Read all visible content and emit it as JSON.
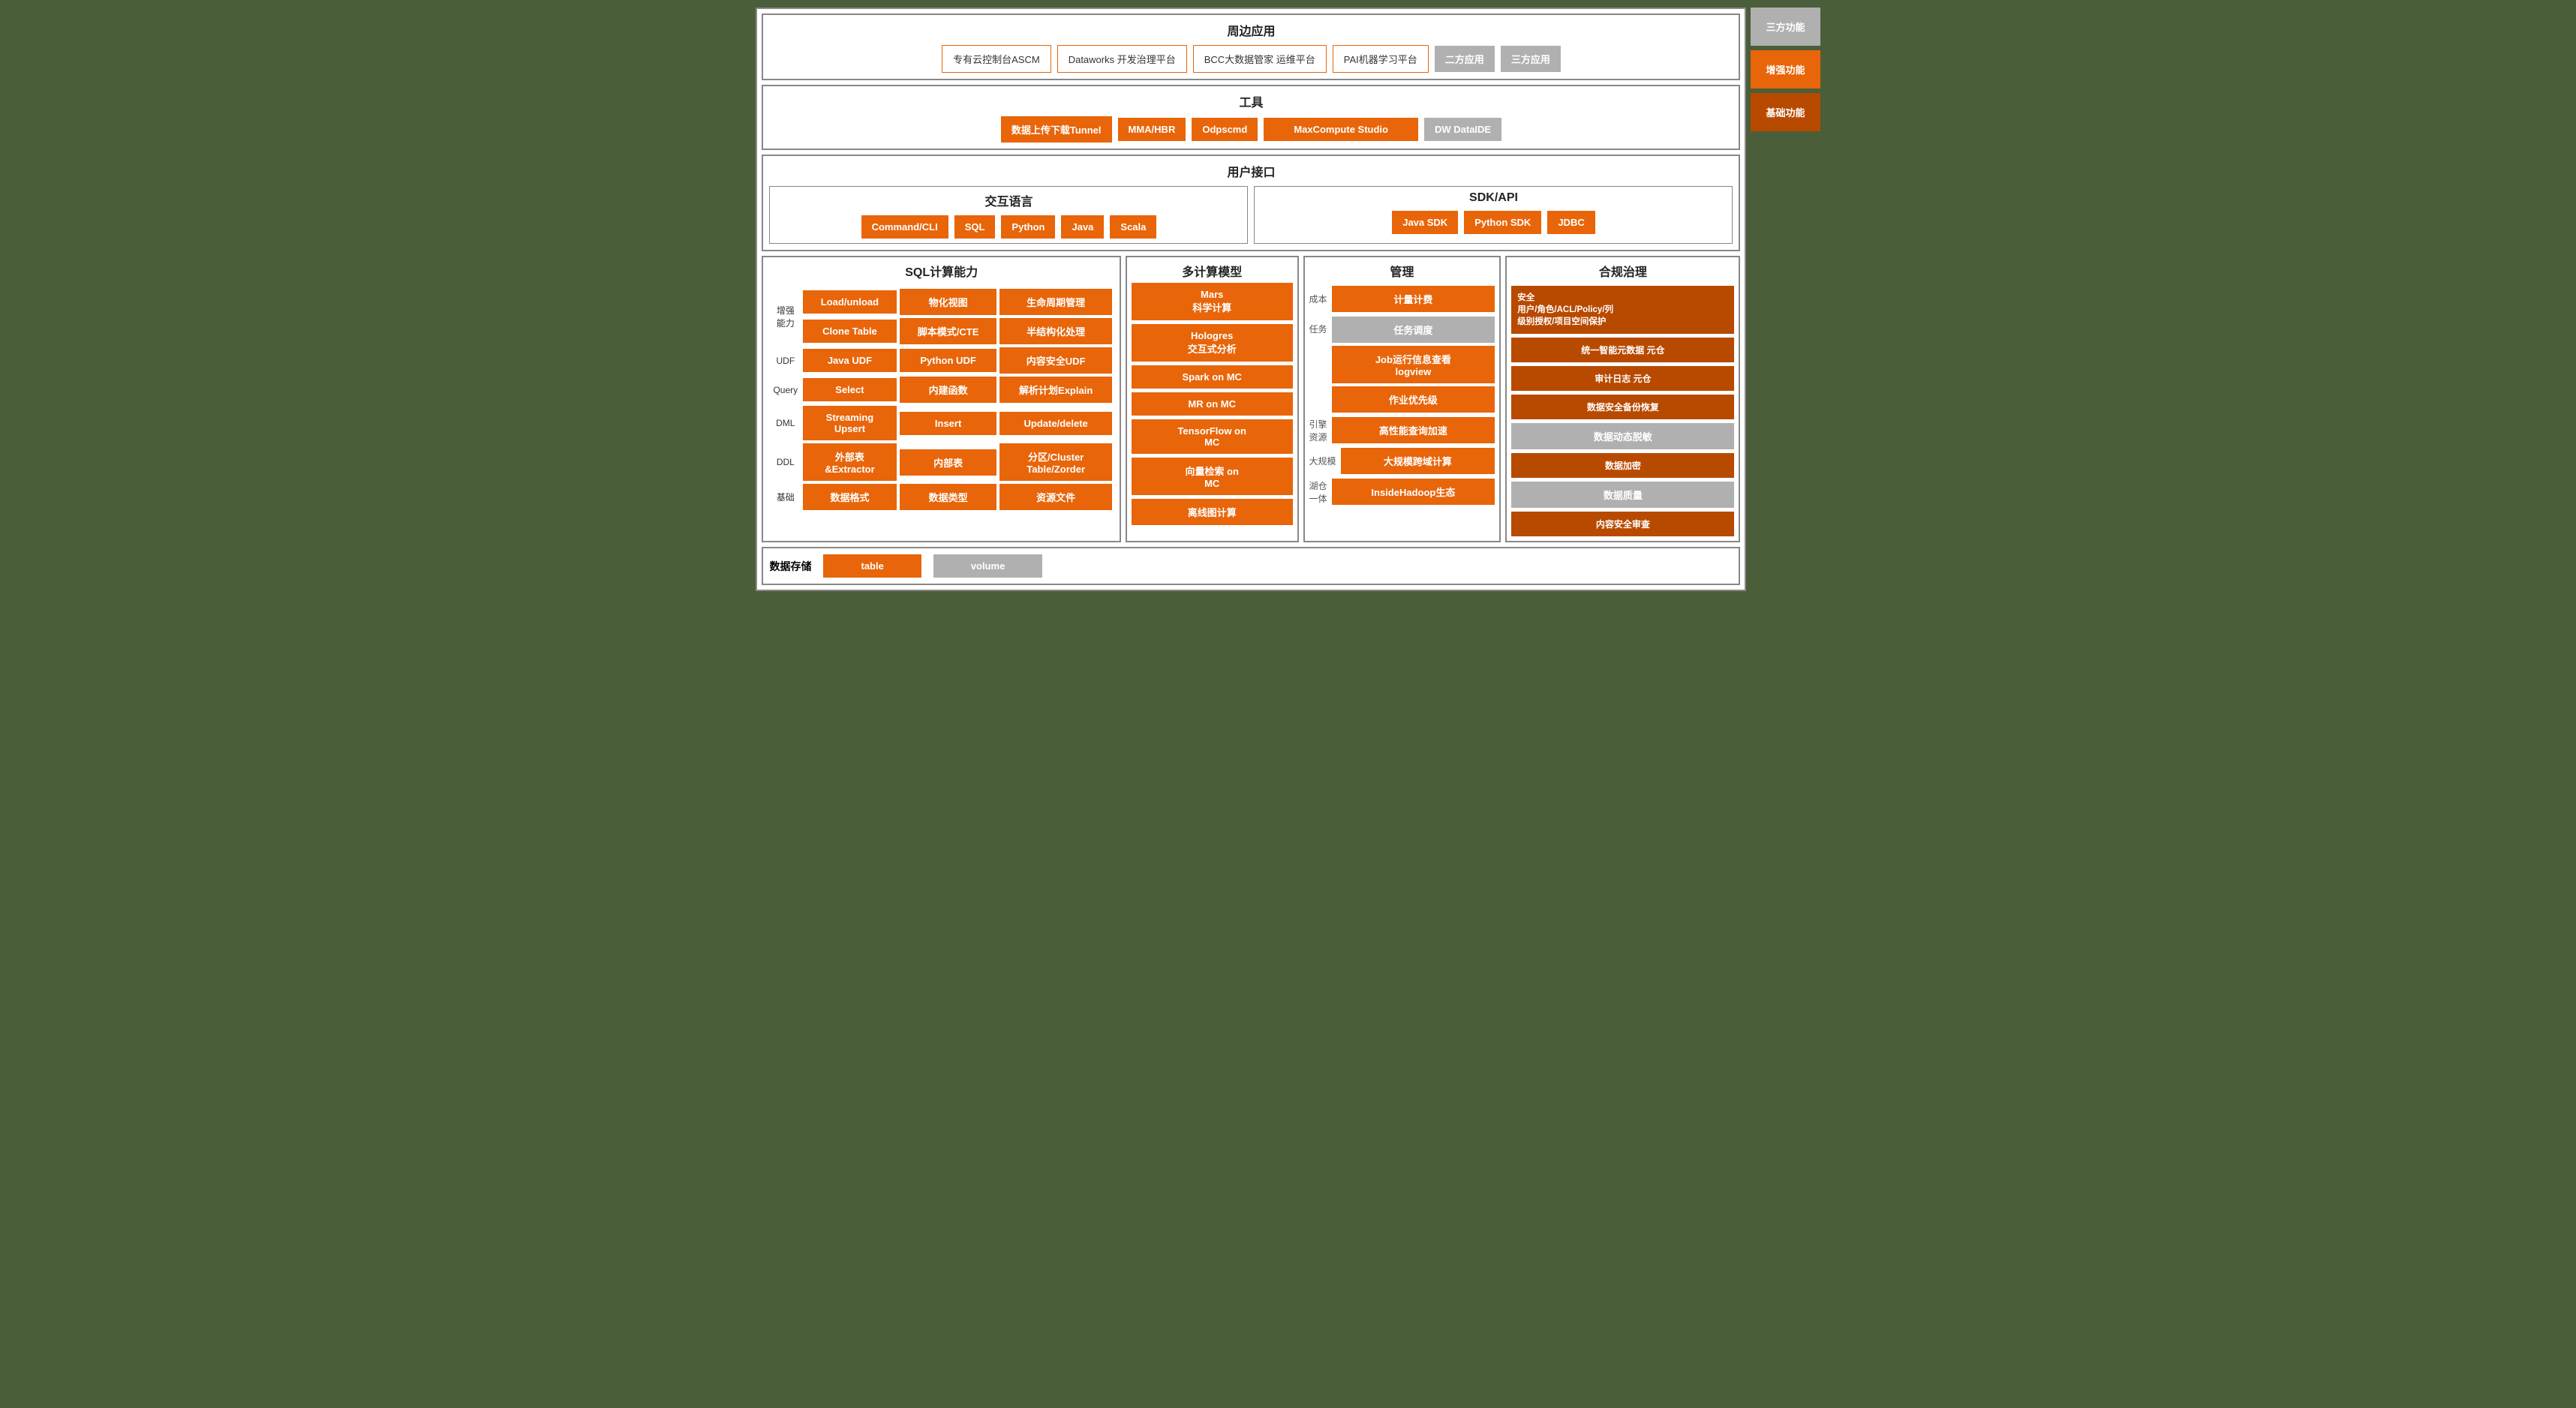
{
  "peripheral": {
    "title": "周边应用",
    "buttons": [
      {
        "label": "专有云控制台ASCM",
        "type": "outline"
      },
      {
        "label": "Dataworks 开发治理平台",
        "type": "outline"
      },
      {
        "label": "BCC大数据管家 运维平台",
        "type": "outline"
      },
      {
        "label": "PAI机器学习平台",
        "type": "outline"
      },
      {
        "label": "二方应用",
        "type": "gray"
      },
      {
        "label": "三方应用",
        "type": "gray"
      }
    ]
  },
  "tools": {
    "title": "工具",
    "buttons": [
      {
        "label": "数据上传下载Tunnel",
        "type": "orange"
      },
      {
        "label": "MMA/HBR",
        "type": "orange"
      },
      {
        "label": "Odpscmd",
        "type": "orange"
      },
      {
        "label": "MaxCompute Studio",
        "type": "orange"
      },
      {
        "label": "DW DataIDE",
        "type": "gray"
      }
    ]
  },
  "userInterface": {
    "title": "用户接口",
    "lang": {
      "title": "交互语言",
      "buttons": [
        {
          "label": "Command/CLI",
          "type": "orange"
        },
        {
          "label": "SQL",
          "type": "orange"
        },
        {
          "label": "Python",
          "type": "orange"
        },
        {
          "label": "Java",
          "type": "orange"
        },
        {
          "label": "Scala",
          "type": "orange"
        }
      ]
    },
    "sdk": {
      "title": "SDK/API",
      "buttons": [
        {
          "label": "Java SDK",
          "type": "orange"
        },
        {
          "label": "Python SDK",
          "type": "orange"
        },
        {
          "label": "JDBC",
          "type": "orange"
        }
      ]
    }
  },
  "sql": {
    "title": "SQL计算能力",
    "rows": [
      {
        "label": "增强\n能力",
        "cells": [
          {
            "label": "Load/unload",
            "type": "orange"
          },
          {
            "label": "物化视图",
            "type": "orange"
          },
          {
            "label": "生命周期管理",
            "type": "orange"
          }
        ]
      },
      {
        "label": "",
        "cells": [
          {
            "label": "Clone Table",
            "type": "orange"
          },
          {
            "label": "脚本模式/CTE",
            "type": "orange"
          },
          {
            "label": "半结构化处理",
            "type": "orange"
          }
        ]
      },
      {
        "label": "UDF",
        "cells": [
          {
            "label": "Java UDF",
            "type": "orange"
          },
          {
            "label": "Python UDF",
            "type": "orange"
          },
          {
            "label": "内容安全UDF",
            "type": "orange"
          }
        ]
      },
      {
        "label": "Query",
        "cells": [
          {
            "label": "Select",
            "type": "orange"
          },
          {
            "label": "内建函数",
            "type": "orange"
          },
          {
            "label": "解析计划Explain",
            "type": "orange"
          }
        ]
      },
      {
        "label": "DML",
        "cells": [
          {
            "label": "Streaming\nUpsert",
            "type": "orange"
          },
          {
            "label": "Insert",
            "type": "orange"
          },
          {
            "label": "Update/delete",
            "type": "orange"
          }
        ]
      },
      {
        "label": "DDL",
        "cells": [
          {
            "label": "外部表\n&Extractor",
            "type": "orange"
          },
          {
            "label": "内部表",
            "type": "orange"
          },
          {
            "label": "分区/Cluster\nTable/Zorder",
            "type": "orange"
          }
        ]
      },
      {
        "label": "基础",
        "cells": [
          {
            "label": "数据格式",
            "type": "orange"
          },
          {
            "label": "数据类型",
            "type": "orange"
          },
          {
            "label": "资源文件",
            "type": "orange"
          }
        ]
      }
    ]
  },
  "compute": {
    "title": "多计算模型",
    "items": [
      {
        "label": "Mars\n科学计算",
        "type": "orange"
      },
      {
        "label": "Hologres\n交互式分析",
        "type": "orange"
      },
      {
        "label": "Spark on MC",
        "type": "orange"
      },
      {
        "label": "MR on MC",
        "type": "orange"
      },
      {
        "label": "TensorFlow on\nMC",
        "type": "orange"
      },
      {
        "label": "向量检索 on\nMC",
        "type": "orange"
      },
      {
        "label": "离线图计算",
        "type": "orange"
      }
    ]
  },
  "management": {
    "title": "管理",
    "groups": [
      {
        "label": "成本",
        "items": [
          {
            "label": "计量计费",
            "type": "orange"
          }
        ]
      },
      {
        "label": "任务",
        "items": [
          {
            "label": "任务调度",
            "type": "gray"
          },
          {
            "label": "Job运行信息查看\nlogview",
            "type": "orange"
          },
          {
            "label": "作业优先级",
            "type": "orange"
          }
        ]
      },
      {
        "label": "引擎\n资源",
        "items": [
          {
            "label": "高性能查询加速",
            "type": "orange"
          }
        ]
      },
      {
        "label": "大规模",
        "items": [
          {
            "label": "大规模跨域计算",
            "type": "orange"
          }
        ]
      },
      {
        "label": "湖仓\n一体",
        "items": [
          {
            "label": "InsideHadoop生态",
            "type": "orange"
          }
        ]
      }
    ]
  },
  "compliance": {
    "title": "合规治理",
    "items": [
      {
        "label": "安全\n用户/角色/ACL/Policy/列\n级别授权/项目空间保护",
        "type": "dark-orange"
      },
      {
        "label": "统一智能元数据 元仓",
        "type": "dark-orange"
      },
      {
        "label": "审计日志 元仓",
        "type": "dark-orange"
      },
      {
        "label": "数据安全备份恢复",
        "type": "dark-orange"
      },
      {
        "label": "数据动态脱敏",
        "type": "gray"
      },
      {
        "label": "数据加密",
        "type": "dark-orange"
      },
      {
        "label": "数据质量",
        "type": "gray"
      },
      {
        "label": "内容安全审查",
        "type": "dark-orange"
      }
    ]
  },
  "storage": {
    "label": "数据存储",
    "buttons": [
      {
        "label": "table",
        "type": "orange"
      },
      {
        "label": "volume",
        "type": "gray"
      }
    ]
  },
  "legend": {
    "items": [
      {
        "label": "三方功能",
        "type": "gray"
      },
      {
        "label": "增强功能",
        "type": "orange"
      },
      {
        "label": "基础功能",
        "type": "dark-orange"
      }
    ]
  }
}
